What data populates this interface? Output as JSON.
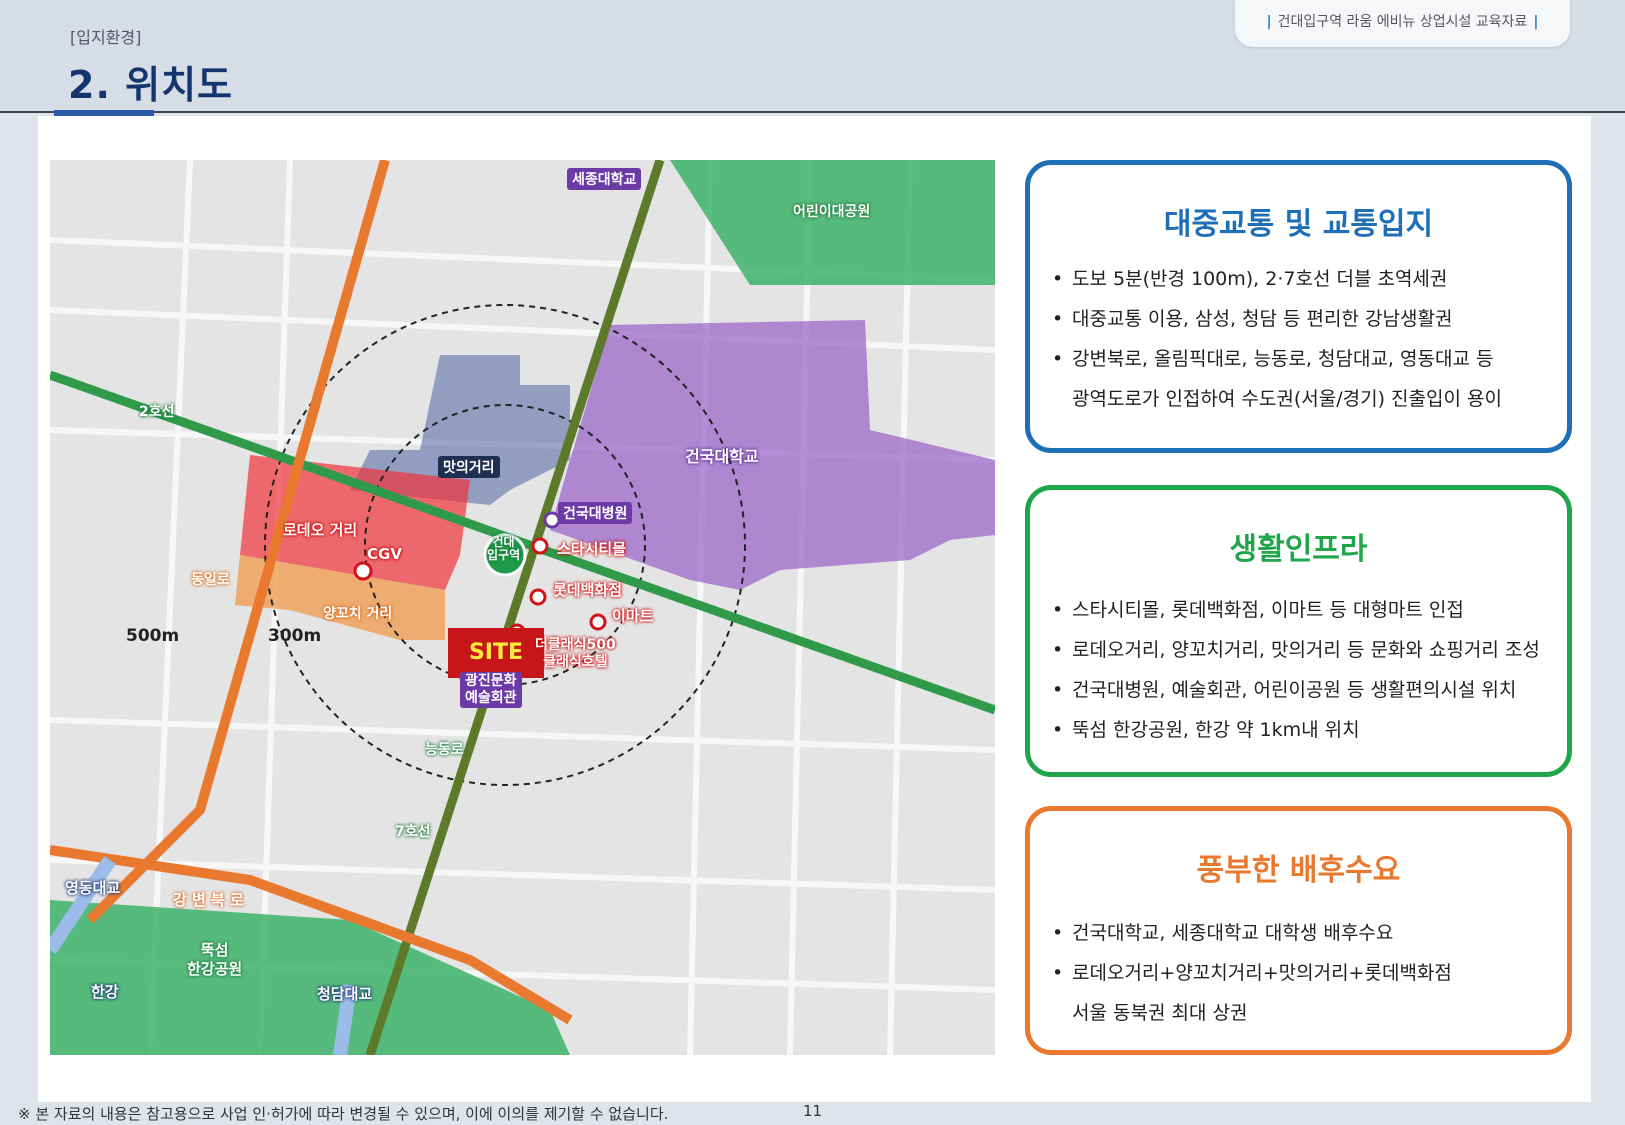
{
  "header": {
    "category": "[입지환경]",
    "title": "2. 위치도",
    "badge": "건대입구역 라움 에비뉴 상업시설 교육자료"
  },
  "map": {
    "labels": {
      "sejong": "세종대학교",
      "childpark": "어린이대공원",
      "line2": "2호선",
      "matui": "맛의거리",
      "konkuk_univ": "건국대학교",
      "konkuk_hosp": "건국대병원",
      "station": "건대\n입구역",
      "rodeo": "로데오 거리",
      "cgv": "CGV",
      "starcity": "스타시티몰",
      "lotte": "롯데백화점",
      "yangkko": "양꼬치 거리",
      "emart": "이마트",
      "site": "SITE",
      "classic500": "더클래식500\n클래식호텔",
      "gwangjin_art": "광진문화\n예술회관",
      "neungdong": "능동로",
      "dongil": "동일로",
      "line7": "7호선",
      "youngdong": "영동대교",
      "gangbyeon": "강 변 북 로",
      "ttukseom": "뚝섬\n한강공원",
      "hangang": "한강",
      "cheongdam": "청담대교",
      "r500": "500m",
      "r300": "300m"
    }
  },
  "cards": [
    {
      "title": "대중교통 및 교통입지",
      "color": "#1f6fb8",
      "items": [
        "도보 5분(반경 100m), 2·7호선 더블 초역세권",
        "대중교통 이용, 삼성, 청담 등 편리한 강남생활권",
        "강변북로, 올림픽대로, 능동로, 청담대교, 영동대교 등",
        "광역도로가 인접하여 수도권(서울/경기) 진출입이 용이"
      ]
    },
    {
      "title": "생활인프라",
      "color": "#1fa64a",
      "items": [
        "스타시티몰, 롯데백화점, 이마트 등 대형마트 인접",
        "로데오거리, 양꼬치거리, 맛의거리 등 문화와 쇼핑거리 조성",
        "건국대병원, 예술회관, 어린이공원 등 생활편의시설 위치",
        "뚝섬 한강공원, 한강 약 1km내 위치"
      ]
    },
    {
      "title": "풍부한 배후수요",
      "color": "#e8792e",
      "items": [
        "건국대학교, 세종대학교 대학생 배후수요",
        "로데오거리+양꼬치거리+맛의거리+롯데백화점",
        "서울 동북권 최대 상권"
      ]
    }
  ],
  "footer": {
    "note": "※ 본 자료의 내용은 참고용으로 사업 인·허가에 따라 변경될 수 있으며, 이에 이의를 제기할 수 없습니다.",
    "page": "11"
  }
}
